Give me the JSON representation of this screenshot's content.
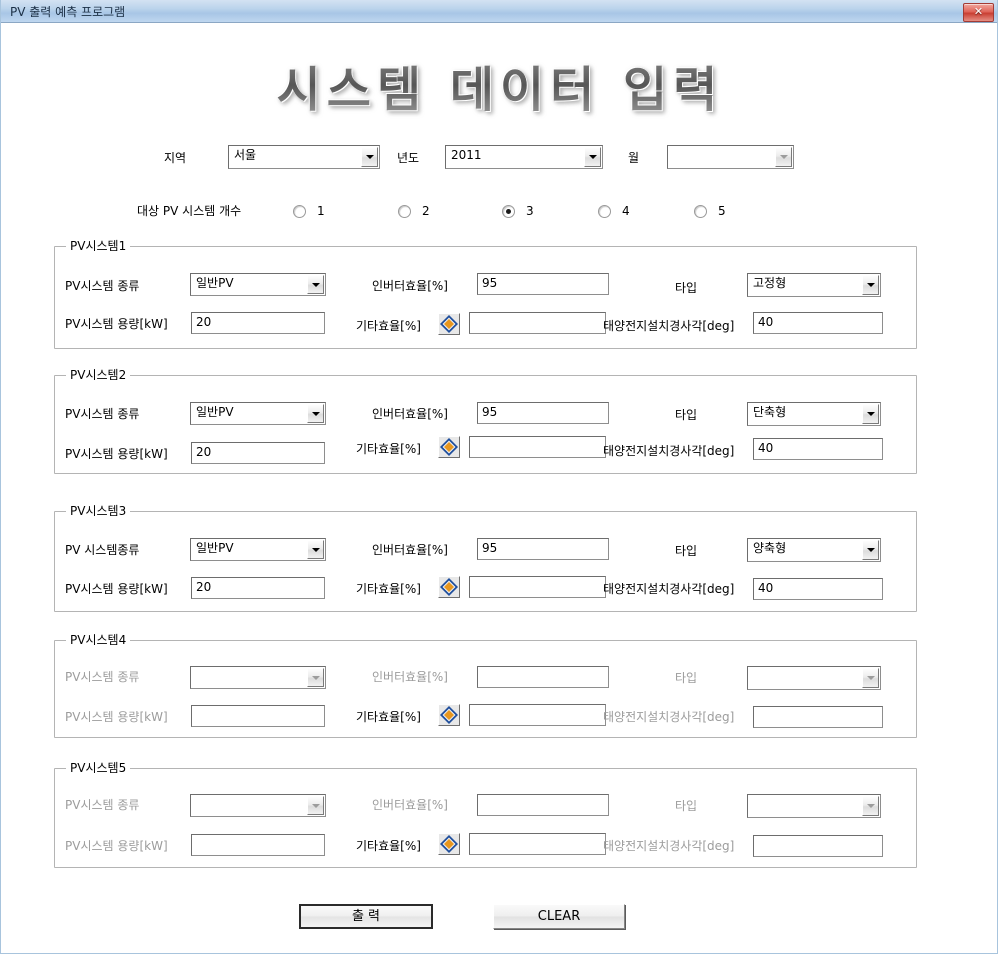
{
  "window": {
    "title": "PV 출력 예측 프로그램",
    "close_label": "✕"
  },
  "heading": "시스템 데이터 입력",
  "top_row": {
    "region_label": "지역",
    "region_value": "서울",
    "year_label": "년도",
    "year_value": "2011",
    "month_label": "월",
    "month_value": ""
  },
  "count_row": {
    "label": "대상 PV 시스템 개수",
    "options": [
      "1",
      "2",
      "3",
      "4",
      "5"
    ],
    "selected": "3"
  },
  "field_labels": {
    "kind": "PV시스템 종류",
    "kind_alt": "PV 시스템종류",
    "capacity": "PV시스템 용량[kW]",
    "inverter": "인버터효율[%]",
    "other_eff": "기타효율[%]",
    "type": "타입",
    "tilt": "태양전지설치경사각[deg]",
    "icon": "diamond-icon"
  },
  "groups": [
    {
      "title": "PV시스템1",
      "kind_label": "PV시스템 종류",
      "kind": "일반PV",
      "capacity": "20",
      "inverter": "95",
      "other_eff": "",
      "type": "고정형",
      "tilt": "40",
      "enabled": true
    },
    {
      "title": "PV시스템2",
      "kind_label": "PV시스템 종류",
      "kind": "일반PV",
      "capacity": "20",
      "inverter": "95",
      "other_eff": "",
      "type": "단축형",
      "tilt": "40",
      "enabled": true
    },
    {
      "title": "PV시스템3",
      "kind_label": "PV 시스템종류",
      "kind": "일반PV",
      "capacity": "20",
      "inverter": "95",
      "other_eff": "",
      "type": "양축형",
      "tilt": "40",
      "enabled": true
    },
    {
      "title": "PV시스템4",
      "kind_label": "PV시스템 종류",
      "kind": "",
      "capacity": "",
      "inverter": "",
      "other_eff": "",
      "type": "",
      "tilt": "",
      "enabled": false
    },
    {
      "title": "PV시스템5",
      "kind_label": "PV시스템 종류",
      "kind": "",
      "capacity": "",
      "inverter": "",
      "other_eff": "",
      "type": "",
      "tilt": "",
      "enabled": false
    }
  ],
  "footer": {
    "print_label": "출  력",
    "clear_label": "CLEAR"
  },
  "colors": {
    "titlebar": "#a8c6e6",
    "close_button": "#c93f33",
    "group_border": "#b4b4b4",
    "disabled_text": "#9c9c9c",
    "icon_orange": "#e8971f",
    "icon_blue": "#1f4e9c"
  }
}
